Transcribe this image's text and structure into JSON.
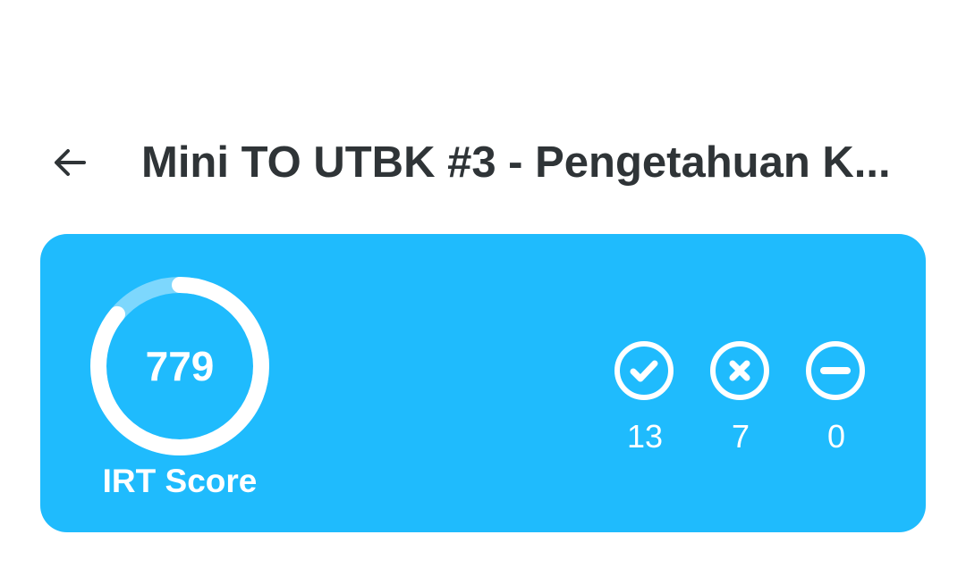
{
  "header": {
    "back_icon": "arrow-left-icon",
    "title": "Mini TO UTBK #3 - Pengetahuan K..."
  },
  "score_card": {
    "background_color": "#1fbbfd",
    "score": "779",
    "score_label": "IRT Score",
    "ring_progress": 0.86,
    "stats": [
      {
        "name": "correct",
        "icon": "check-circle-icon",
        "value": "13"
      },
      {
        "name": "wrong",
        "icon": "x-circle-icon",
        "value": "7"
      },
      {
        "name": "empty",
        "icon": "minus-circle-icon",
        "value": "0"
      }
    ]
  }
}
